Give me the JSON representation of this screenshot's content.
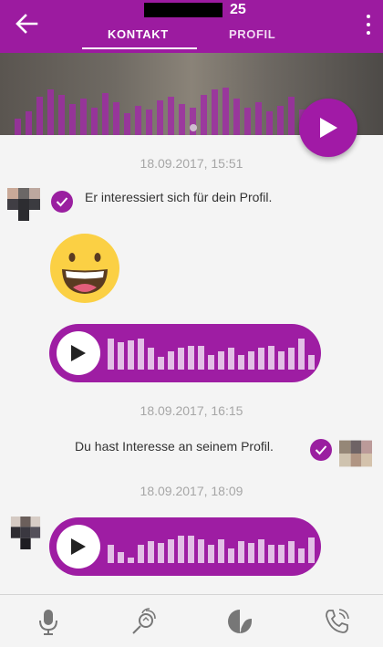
{
  "header": {
    "age": "25",
    "tabs": [
      {
        "label": "KONTAKT",
        "active": true
      },
      {
        "label": "PROFIL",
        "active": false
      }
    ]
  },
  "colors": {
    "brand": "#9c1ba0",
    "accent": "#a11aa6",
    "timestamp": "#a6a6a6"
  },
  "icons": {
    "back": "arrow-left-icon",
    "menu": "more-vert-icon",
    "play": "play-icon",
    "check": "check-circle-icon",
    "mic": "microphone-icon",
    "horn": "horn-icon",
    "sticker": "sticker-icon",
    "call": "phone-icon"
  },
  "chat": {
    "messages": [
      {
        "timestamp": "18.09.2017, 15:51",
        "text": "Er interessiert sich für dein Profil."
      },
      {
        "timestamp": "18.09.2017, 16:15",
        "text": "Du hast Interesse an seinem Profil."
      },
      {
        "timestamp": "18.09.2017, 18:09"
      }
    ]
  }
}
